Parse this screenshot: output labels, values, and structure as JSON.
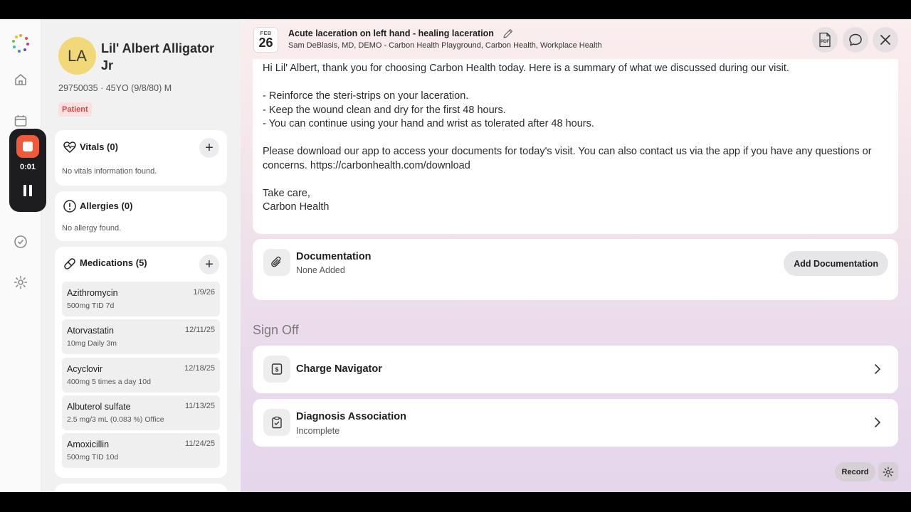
{
  "rail": {
    "icons": [
      "logo-icon",
      "home-icon",
      "calendar-icon",
      "check-circle-icon",
      "gear-icon"
    ]
  },
  "recorder": {
    "timer": "0:01",
    "stop_color": "#f05a3a"
  },
  "patient": {
    "initials": "LA",
    "name": "Lil' Albert Alligator Jr",
    "meta": "29750035 · 45YO (9/8/80) M",
    "badge": "Patient",
    "avatar_color": "#f1d97a"
  },
  "vitals": {
    "title": "Vitals (0)",
    "empty": "No vitals information found."
  },
  "allergies": {
    "title": "Allergies (0)",
    "empty": "No allergy found."
  },
  "medications": {
    "title": "Medications (5)",
    "items": [
      {
        "name": "Azithromycin",
        "dose": "500mg TID 7d",
        "date": "1/9/26"
      },
      {
        "name": "Atorvastatin",
        "dose": "10mg Daily 3m",
        "date": "12/11/25"
      },
      {
        "name": "Acyclovir",
        "dose": "400mg 5 times a day 10d",
        "date": "12/18/25"
      },
      {
        "name": "Albuterol sulfate",
        "dose": "2.5 mg/3 mL (0.083 %) Office",
        "date": "11/13/25"
      },
      {
        "name": "Amoxicillin",
        "dose": "500mg TID 10d",
        "date": "11/24/25"
      }
    ]
  },
  "header": {
    "month": "FEB",
    "day": "26",
    "title": "Acute laceration on left hand - healing laceration",
    "subtitle": "Sam DeBlasis, MD, DEMO - Carbon Health Playground, Carbon Health, Workplace Health",
    "pdf_label": "PDF"
  },
  "summary": {
    "greeting": "Hi Lil' Albert, thank you for choosing Carbon Health today. Here is a summary of what we discussed during our visit.",
    "bullets": [
      "- Reinforce the steri-strips on your laceration.",
      "- Keep the wound clean and dry for the first 48 hours.",
      "- You can continue using your hand and wrist as tolerated after 48 hours."
    ],
    "download": "Please download our app to access your documents for today's visit. You can also contact us via the app if you have any questions or concerns. https://carbonhealth.com/download",
    "closing1": "Take care,",
    "closing2": "Carbon Health"
  },
  "documentation": {
    "title": "Documentation",
    "status": "None Added",
    "button": "Add Documentation"
  },
  "signoff": {
    "heading": "Sign Off",
    "charge": {
      "title": "Charge Navigator"
    },
    "diagnosis": {
      "title": "Diagnosis Association",
      "status": "Incomplete"
    }
  },
  "footer": {
    "record_label": "Record"
  }
}
